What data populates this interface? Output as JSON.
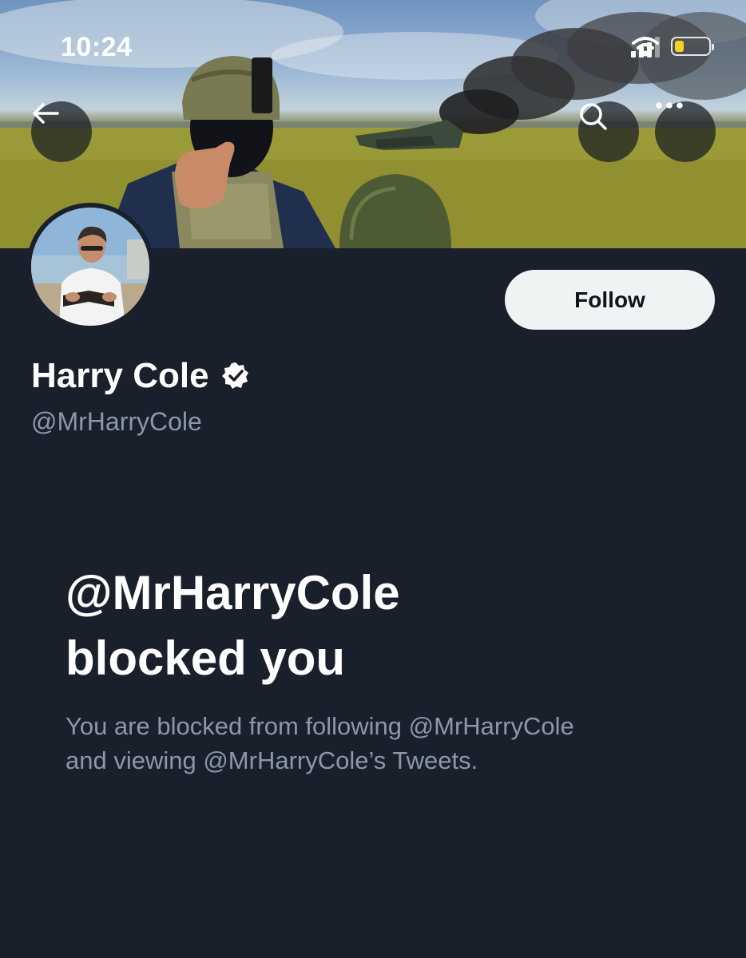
{
  "status_bar": {
    "time": "10:24",
    "icons": [
      "cellular-signal-icon",
      "wifi-icon",
      "battery-icon"
    ],
    "battery_color": "#f7d320"
  },
  "banner": {
    "icons": [
      "back-arrow-icon",
      "search-icon",
      "more-icon"
    ]
  },
  "profile": {
    "display_name": "Harry Cole",
    "handle": "@MrHarryCole",
    "verified_icon": "verified-badge-icon",
    "follow_label": "Follow"
  },
  "blocked": {
    "title_line1": "@MrHarryCole",
    "title_line2": "blocked you",
    "description_line1": "You are blocked from following @MrHarryCole",
    "description_line2": "and viewing @MrHarryCole’s Tweets."
  },
  "colors": {
    "background": "#1a202b",
    "secondary_text": "#8b98a5",
    "follow_bg": "#eff3f4",
    "follow_text": "#0f1419"
  }
}
